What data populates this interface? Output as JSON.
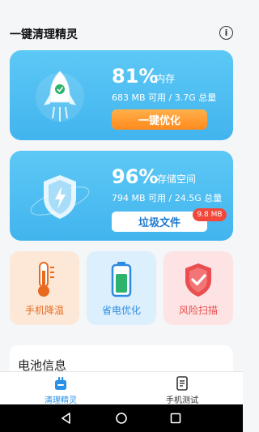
{
  "header": {
    "title": "一键清理精灵",
    "info_glyph": "i"
  },
  "memory_card": {
    "percent": "81%",
    "percent_label": "内存",
    "detail": "683 MB 可用 / 3.7G 总量",
    "button_label": "一键优化",
    "icon": "rocket-icon"
  },
  "storage_card": {
    "percent": "96%",
    "percent_label": "存储空间",
    "detail": "794 MB 可用 / 24.5G 总量",
    "button_label": "垃圾文件",
    "badge": "9.8 MB",
    "icon": "shield-lightning-icon"
  },
  "tools": [
    {
      "label": "手机降温",
      "icon": "thermometer-icon"
    },
    {
      "label": "省电优化",
      "icon": "battery-icon"
    },
    {
      "label": "风险扫描",
      "icon": "shield-check-icon"
    }
  ],
  "battery_section": {
    "title": "电池信息"
  },
  "tabbar": {
    "tabs": [
      {
        "label": "清理精灵",
        "icon": "cleaner-icon",
        "active": true
      },
      {
        "label": "手机测试",
        "icon": "phone-test-icon",
        "active": false
      }
    ]
  },
  "colors": {
    "card_gradient_top": "#5cc8f5",
    "card_gradient_bottom": "#42b4ee",
    "optimize_button": "#ff8a1d",
    "badge_red": "#f2473a",
    "active_tab": "#2a90e8"
  }
}
